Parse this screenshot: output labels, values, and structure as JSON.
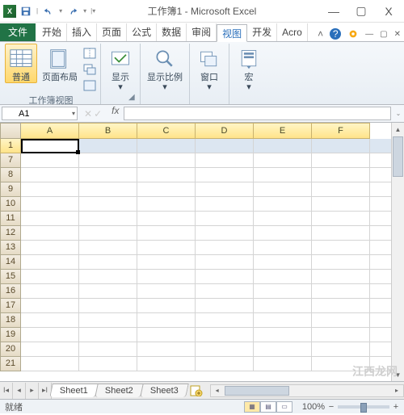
{
  "titlebar": {
    "title": "工作簿1 - Microsoft Excel",
    "app_icon_letter": "X"
  },
  "window_controls": {
    "minimize": "—",
    "maximize": "▢",
    "close": "X"
  },
  "qat": {
    "save": "save-icon",
    "undo": "undo-icon",
    "redo": "redo-icon"
  },
  "ribbon": {
    "file": "文件",
    "tabs": [
      "开始",
      "插入",
      "页面",
      "公式",
      "数据",
      "审阅",
      "视图",
      "开发",
      "Acro"
    ],
    "active_index": 6,
    "help": "?",
    "expand": "^"
  },
  "ribbon_body": {
    "group_views": {
      "normal": "普通",
      "page_layout": "页面布局",
      "small_btns": [
        "分页预览",
        "自定义视图",
        "全屏"
      ],
      "label": "工作簿视图"
    },
    "group_show": {
      "btn": "显示",
      "label": ""
    },
    "group_zoom": {
      "btn": "显示比例",
      "label": ""
    },
    "group_window": {
      "btn": "窗口",
      "label": ""
    },
    "group_macros": {
      "btn": "宏",
      "label": ""
    }
  },
  "namebox": {
    "value": "A1"
  },
  "formula_bar": {
    "fx": "fx",
    "value": ""
  },
  "columns": [
    "A",
    "B",
    "C",
    "D",
    "E",
    "F"
  ],
  "rows": [
    1,
    7,
    8,
    9,
    10,
    11,
    12,
    13,
    14,
    15,
    16,
    17,
    18,
    19,
    20,
    21
  ],
  "selected_row_index": 0,
  "sheet_tabs": {
    "sheets": [
      "Sheet1",
      "Sheet2",
      "Sheet3"
    ],
    "active_index": 0
  },
  "status": {
    "mode": "就绪",
    "zoom": "100%"
  },
  "watermark": "江西龙网"
}
